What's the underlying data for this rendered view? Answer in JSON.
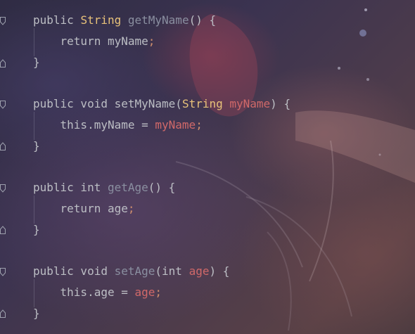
{
  "editor": {
    "lines": [
      {
        "tokens": [
          {
            "t": "public ",
            "c": "punc"
          },
          {
            "t": "String",
            "c": "type"
          },
          {
            "t": " ",
            "c": "punc"
          },
          {
            "t": "getMyName",
            "c": "fn-dim"
          },
          {
            "t": "() {",
            "c": "punc"
          }
        ]
      },
      {
        "tokens": [
          {
            "t": "    return ",
            "c": "punc"
          },
          {
            "t": "myName",
            "c": "punc"
          },
          {
            "t": ";",
            "c": "semi"
          }
        ]
      },
      {
        "tokens": [
          {
            "t": "}",
            "c": "punc"
          }
        ]
      },
      {
        "tokens": []
      },
      {
        "tokens": [
          {
            "t": "public void ",
            "c": "punc"
          },
          {
            "t": "setMyName",
            "c": "punc"
          },
          {
            "t": "(",
            "c": "punc"
          },
          {
            "t": "String",
            "c": "type"
          },
          {
            "t": " ",
            "c": "punc"
          },
          {
            "t": "myName",
            "c": "param"
          },
          {
            "t": ") {",
            "c": "punc"
          }
        ]
      },
      {
        "tokens": [
          {
            "t": "    this.myName = ",
            "c": "punc"
          },
          {
            "t": "myName",
            "c": "param"
          },
          {
            "t": ";",
            "c": "semi"
          }
        ]
      },
      {
        "tokens": [
          {
            "t": "}",
            "c": "punc"
          }
        ]
      },
      {
        "tokens": []
      },
      {
        "tokens": [
          {
            "t": "public int ",
            "c": "punc"
          },
          {
            "t": "getAge",
            "c": "fn-dim"
          },
          {
            "t": "() {",
            "c": "punc"
          }
        ]
      },
      {
        "tokens": [
          {
            "t": "    return age",
            "c": "punc"
          },
          {
            "t": ";",
            "c": "semi"
          }
        ]
      },
      {
        "tokens": [
          {
            "t": "}",
            "c": "punc"
          }
        ]
      },
      {
        "tokens": []
      },
      {
        "tokens": [
          {
            "t": "public void ",
            "c": "punc"
          },
          {
            "t": "setAge",
            "c": "fn-dim"
          },
          {
            "t": "(int ",
            "c": "punc"
          },
          {
            "t": "age",
            "c": "param"
          },
          {
            "t": ") {",
            "c": "punc"
          }
        ]
      },
      {
        "tokens": [
          {
            "t": "    this.age = ",
            "c": "punc"
          },
          {
            "t": "age",
            "c": "param"
          },
          {
            "t": ";",
            "c": "semi"
          }
        ]
      },
      {
        "tokens": [
          {
            "t": "}",
            "c": "punc"
          }
        ]
      }
    ]
  },
  "gutter": {
    "fold_icons": [
      "fold-start-icon",
      "fold-end-icon"
    ]
  },
  "colors": {
    "keyword": "#cf8e6d",
    "type": "#e8c27a",
    "method_dim": "#8a8fa0",
    "param": "#d16969",
    "text": "#bcbec4"
  }
}
